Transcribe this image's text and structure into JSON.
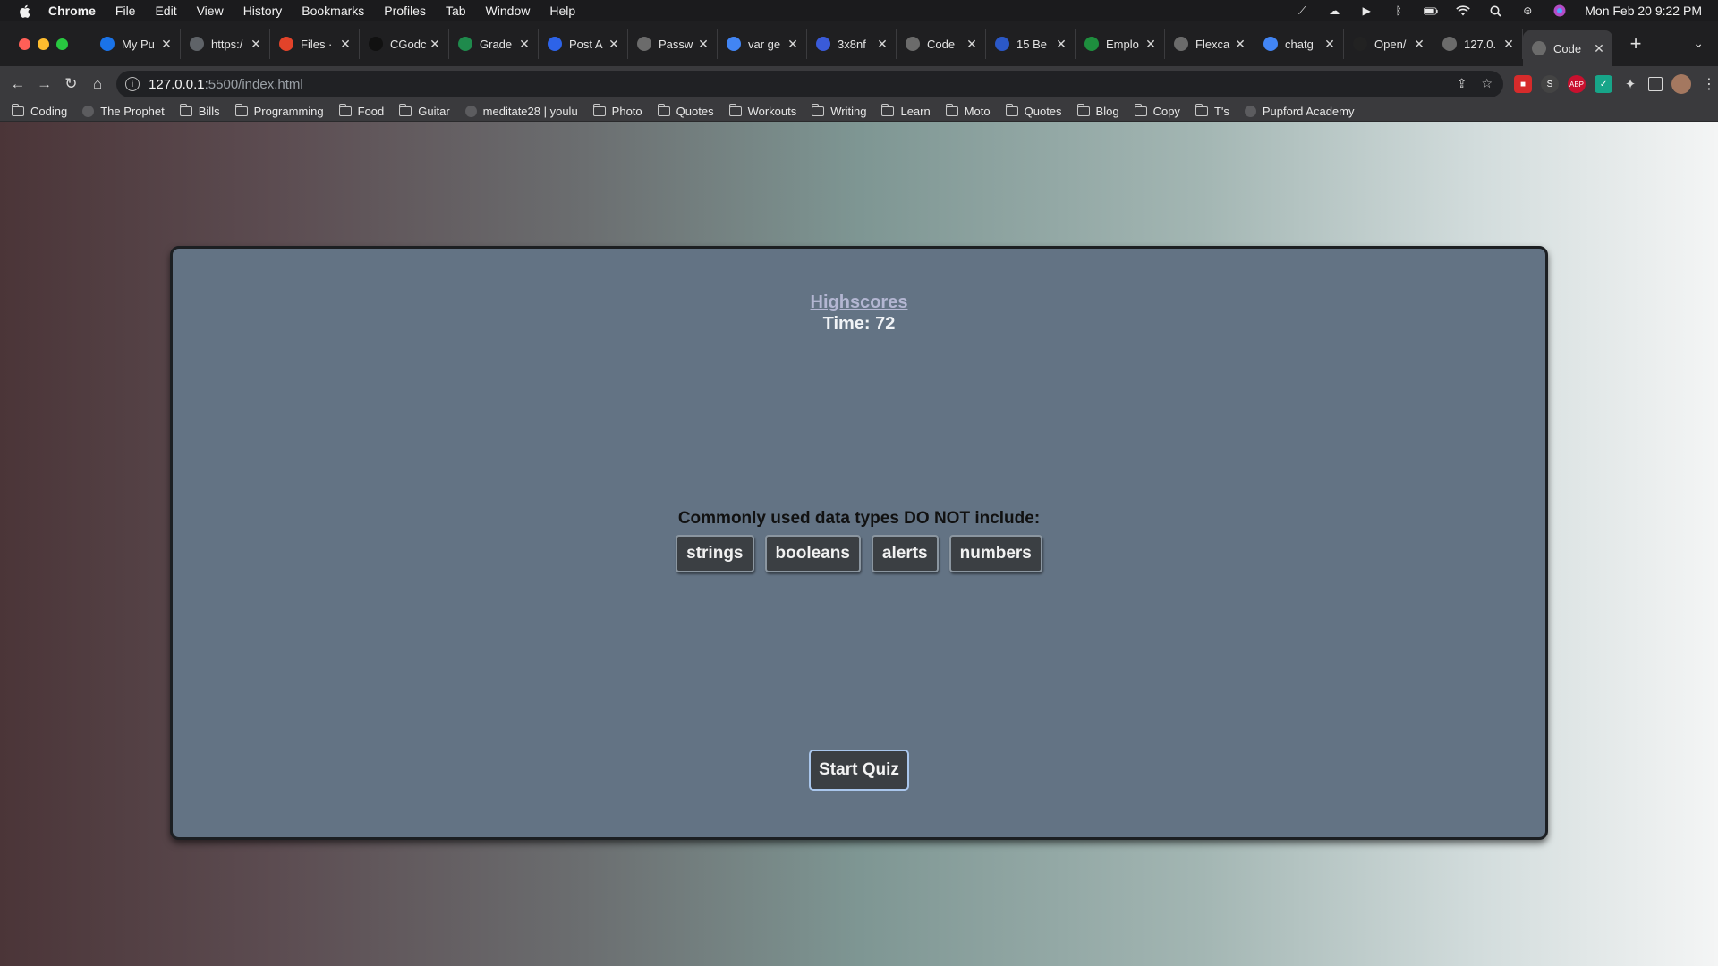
{
  "menubar": {
    "apple_icon": "apple-icon",
    "items": [
      "Chrome",
      "File",
      "Edit",
      "View",
      "History",
      "Bookmarks",
      "Profiles",
      "Tab",
      "Window",
      "Help"
    ],
    "clock": "Mon Feb 20  9:22 PM"
  },
  "tabs": [
    {
      "title": "My Pu",
      "icon": "c-logo",
      "color": "#1a73e8"
    },
    {
      "title": "https:/",
      "icon": "a-logo",
      "color": "#5f6368"
    },
    {
      "title": "Files ·",
      "icon": "gitlab-logo",
      "color": "#e2432a"
    },
    {
      "title": "CGodc",
      "icon": "github-logo",
      "color": "#111111"
    },
    {
      "title": "Grade",
      "icon": "grade-logo",
      "color": "#1f8a4c"
    },
    {
      "title": "Post A",
      "icon": "z-logo",
      "color": "#2d63e8"
    },
    {
      "title": "Passw",
      "icon": "globe-icon",
      "color": "#6b6b6b"
    },
    {
      "title": "var ge",
      "icon": "google-logo",
      "color": "#4285f4"
    },
    {
      "title": "3x8nf",
      "icon": "code-logo",
      "color": "#3a5bd9"
    },
    {
      "title": "Code",
      "icon": "globe-icon",
      "color": "#6b6b6b"
    },
    {
      "title": "15 Be",
      "icon": "dots-logo",
      "color": "#2b58c7"
    },
    {
      "title": "Emplo",
      "icon": "sheet-logo",
      "color": "#1e8e3e"
    },
    {
      "title": "Flexca",
      "icon": "globe-icon",
      "color": "#6b6b6b"
    },
    {
      "title": "chatg",
      "icon": "google-logo",
      "color": "#4285f4"
    },
    {
      "title": "Open/",
      "icon": "openai-logo",
      "color": "#222222"
    },
    {
      "title": "127.0.",
      "icon": "globe-icon",
      "color": "#6b6b6b"
    },
    {
      "title": "Code",
      "icon": "globe-icon",
      "color": "#6b6b6b"
    }
  ],
  "address": {
    "host": "127.0.0.1",
    "path": ":5500/index.html"
  },
  "bookmarks": [
    {
      "label": "Coding",
      "type": "folder"
    },
    {
      "label": "The Prophet",
      "type": "site"
    },
    {
      "label": "Bills",
      "type": "folder"
    },
    {
      "label": "Programming",
      "type": "folder"
    },
    {
      "label": "Food",
      "type": "folder"
    },
    {
      "label": "Guitar",
      "type": "folder"
    },
    {
      "label": "meditate28 | youlu",
      "type": "site"
    },
    {
      "label": "Photo",
      "type": "folder"
    },
    {
      "label": "Quotes",
      "type": "folder"
    },
    {
      "label": "Workouts",
      "type": "folder"
    },
    {
      "label": "Writing",
      "type": "folder"
    },
    {
      "label": "Learn",
      "type": "folder"
    },
    {
      "label": "Moto",
      "type": "folder"
    },
    {
      "label": "Quotes",
      "type": "folder"
    },
    {
      "label": "Blog",
      "type": "folder"
    },
    {
      "label": "Copy",
      "type": "folder"
    },
    {
      "label": "T's",
      "type": "folder"
    },
    {
      "label": "Pupford Academy",
      "type": "site"
    }
  ],
  "quiz": {
    "highscores_link": "Highscores",
    "timer_label": "Time: 72",
    "question": "Commonly used data types DO NOT include:",
    "answers": [
      "strings",
      "booleans",
      "alerts",
      "numbers"
    ],
    "start_button": "Start Quiz"
  },
  "colors": {
    "card_background": "#637384",
    "card_border": "#1c1f22",
    "button_background": "#3b3f43",
    "highscores_link": "#b3b6d2",
    "start_button_border": "#a9c6ec"
  }
}
